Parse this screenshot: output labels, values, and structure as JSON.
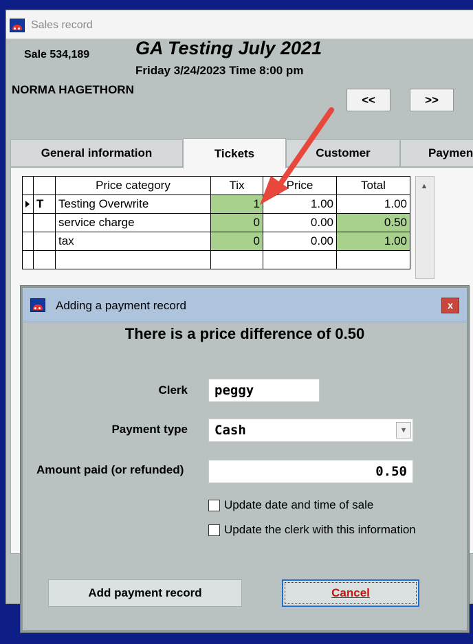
{
  "window": {
    "title": "Sales record"
  },
  "header": {
    "sale_label": "Sale 534,189",
    "event_title": "GA Testing July 2021",
    "event_date": "Friday 3/24/2023  Time 8:00 pm",
    "customer_name": "NORMA HAGETHORN",
    "prev_label": "<<",
    "next_label": ">>"
  },
  "tabs": {
    "general": "General information",
    "tickets": "Tickets",
    "customer": "Customer",
    "payment": "Paymen"
  },
  "grid": {
    "headers": [
      "Price category",
      "Tix",
      "Price",
      "Total"
    ],
    "rows": [
      {
        "type": "T",
        "category": "Testing Overwrite",
        "tix": "1",
        "price": "1.00",
        "total": "1.00"
      },
      {
        "type": "",
        "category": "service charge",
        "tix": "0",
        "price": "0.00",
        "total": "0.50"
      },
      {
        "type": "",
        "category": "tax",
        "tix": "0",
        "price": "0.00",
        "total": "1.00"
      }
    ]
  },
  "dialog": {
    "title": "Adding a payment record",
    "close_label": "x",
    "message": "There is a price difference of 0.50",
    "clerk_label": "Clerk",
    "clerk_value": "peggy",
    "payment_type_label": "Payment type",
    "payment_type_value": "Cash",
    "amount_label": "Amount paid (or refunded)",
    "amount_value": "0.50",
    "checkbox_update_date": "Update date and time of sale",
    "checkbox_update_clerk": "Update the clerk with this information",
    "add_button": "Add payment record",
    "cancel_button": "Cancel"
  },
  "colors": {
    "desktop": "#0d1f86",
    "window": "#b9c1c1",
    "highlight_cell": "#a8d18d",
    "annotation_arrow": "#e8473c",
    "cancel_text": "#c8140e"
  }
}
